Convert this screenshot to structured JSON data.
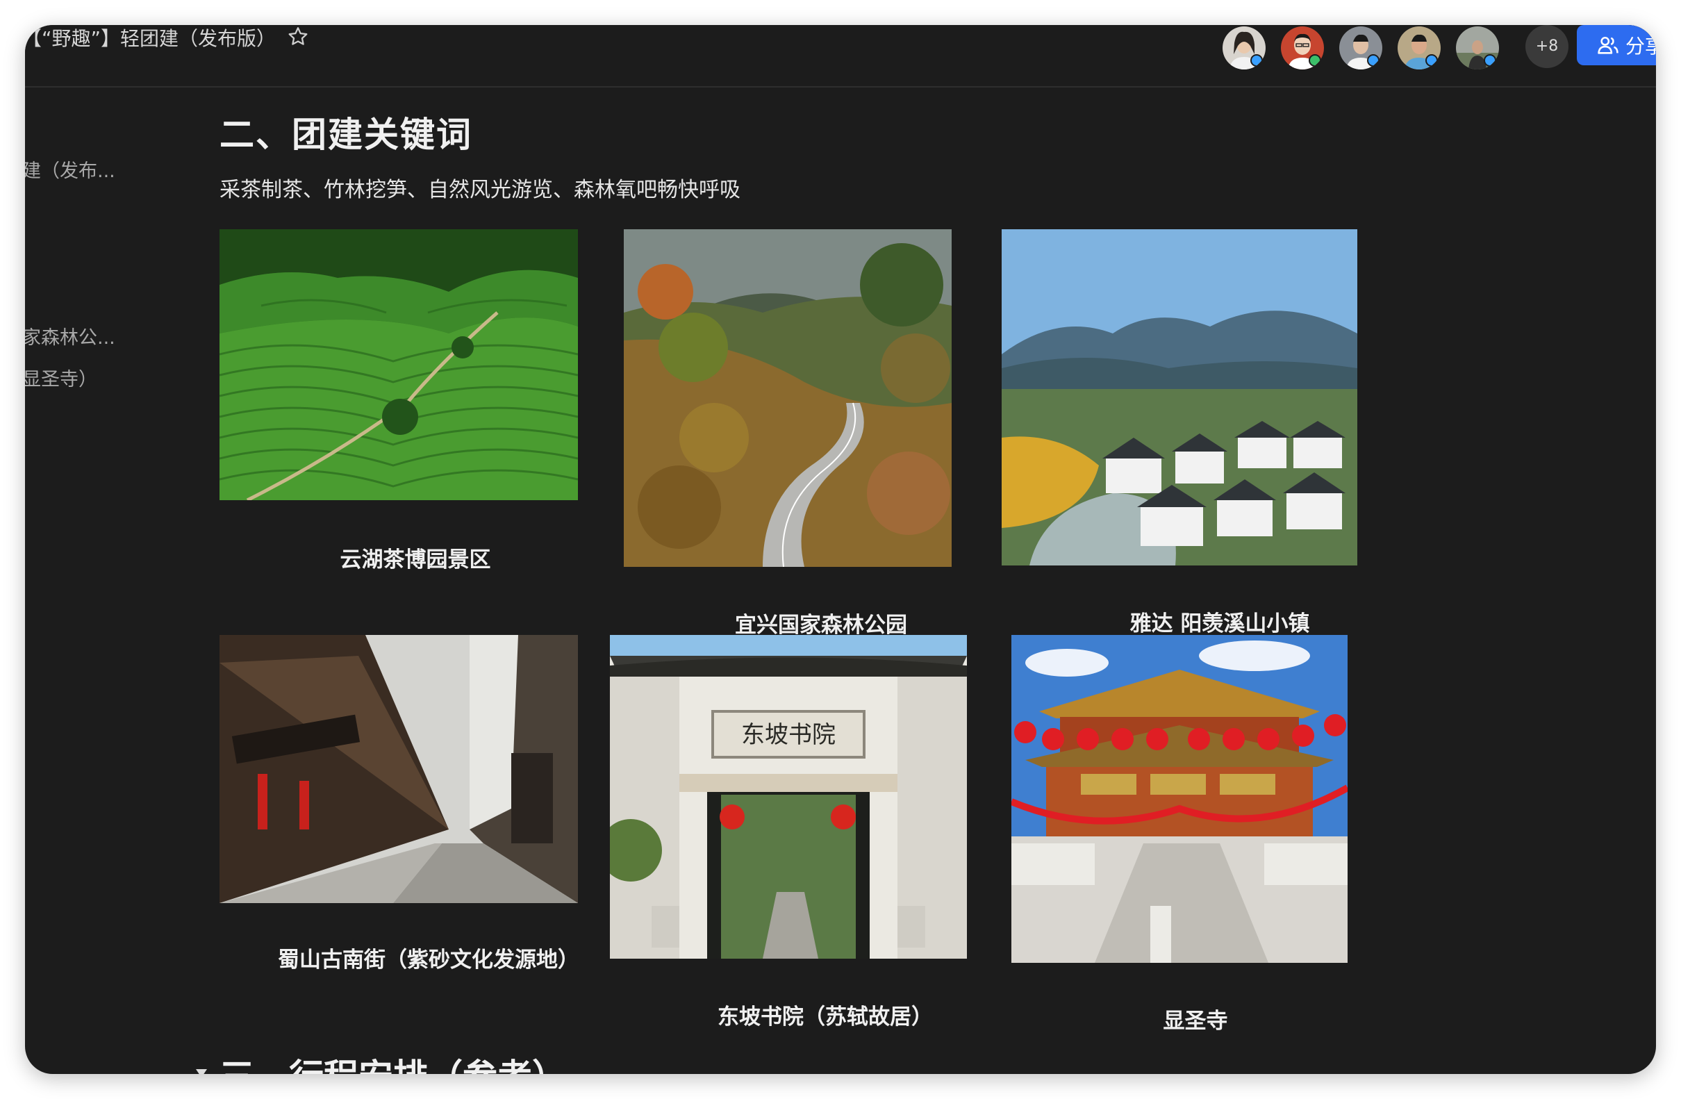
{
  "window": {
    "doc_title": "【“野趣”】轻团建（发布版）",
    "share_label": "分享",
    "avatars": [
      {
        "name": "avatar-1",
        "dot": "#3aa0ff"
      },
      {
        "name": "avatar-2",
        "dot": "#3cc06a"
      },
      {
        "name": "avatar-3",
        "dot": "#3aa0ff"
      },
      {
        "name": "avatar-4",
        "dot": "#3aa0ff"
      },
      {
        "name": "avatar-5",
        "dot": "#3aa0ff"
      }
    ],
    "more_count": "+8"
  },
  "outline": {
    "items": [
      "建（发布...",
      "家森林公...",
      "显圣寺）"
    ]
  },
  "section2": {
    "heading": "二、团建关键词",
    "keywords": "采茶制茶、竹林挖笋、自然风光游览、森林氧吧畅快呼吸",
    "images": [
      {
        "caption": "云湖茶博园景区",
        "scene": "tea-terraces"
      },
      {
        "caption": "宜兴国家森林公园",
        "scene": "forest-road"
      },
      {
        "caption": "雅达 阳羡溪山小镇",
        "scene": "mountain-town"
      },
      {
        "caption": "蜀山古南街（紫砂文化发源地）",
        "scene": "old-street"
      },
      {
        "caption": "东坡书院（苏轼故居）",
        "scene": "academy-gate"
      },
      {
        "caption": "显圣寺",
        "scene": "temple"
      }
    ],
    "academy_plaque": "东坡书院"
  },
  "section3": {
    "heading": "三、行程安排（参考）"
  },
  "colors": {
    "background": "#1c1c1c",
    "accent": "#2d6cf0"
  }
}
